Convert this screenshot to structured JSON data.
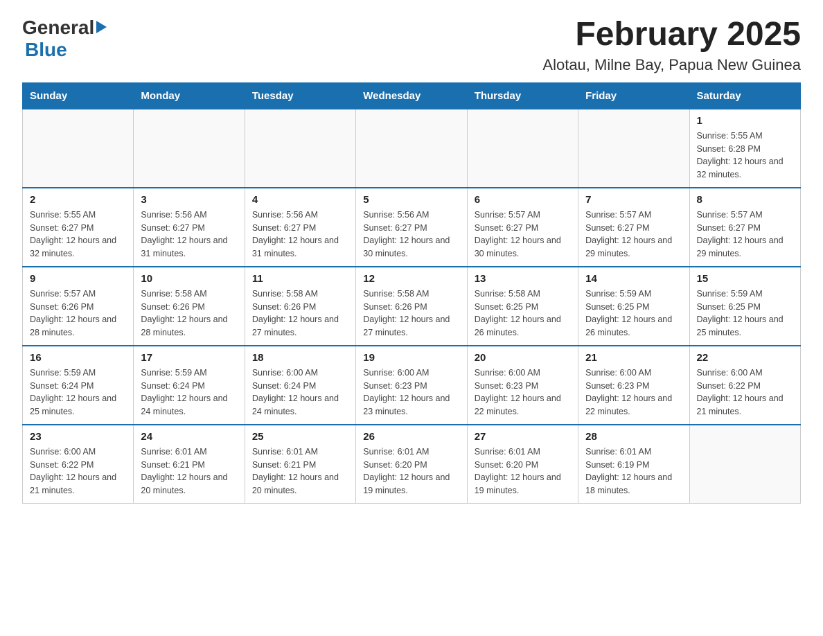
{
  "header": {
    "logo_general": "General",
    "logo_blue": "Blue",
    "month_title": "February 2025",
    "location": "Alotau, Milne Bay, Papua New Guinea"
  },
  "weekdays": [
    "Sunday",
    "Monday",
    "Tuesday",
    "Wednesday",
    "Thursday",
    "Friday",
    "Saturday"
  ],
  "weeks": [
    {
      "days": [
        {
          "number": "",
          "sunrise": "",
          "sunset": "",
          "daylight": "",
          "empty": true
        },
        {
          "number": "",
          "sunrise": "",
          "sunset": "",
          "daylight": "",
          "empty": true
        },
        {
          "number": "",
          "sunrise": "",
          "sunset": "",
          "daylight": "",
          "empty": true
        },
        {
          "number": "",
          "sunrise": "",
          "sunset": "",
          "daylight": "",
          "empty": true
        },
        {
          "number": "",
          "sunrise": "",
          "sunset": "",
          "daylight": "",
          "empty": true
        },
        {
          "number": "",
          "sunrise": "",
          "sunset": "",
          "daylight": "",
          "empty": true
        },
        {
          "number": "1",
          "sunrise": "Sunrise: 5:55 AM",
          "sunset": "Sunset: 6:28 PM",
          "daylight": "Daylight: 12 hours and 32 minutes.",
          "empty": false
        }
      ]
    },
    {
      "days": [
        {
          "number": "2",
          "sunrise": "Sunrise: 5:55 AM",
          "sunset": "Sunset: 6:27 PM",
          "daylight": "Daylight: 12 hours and 32 minutes.",
          "empty": false
        },
        {
          "number": "3",
          "sunrise": "Sunrise: 5:56 AM",
          "sunset": "Sunset: 6:27 PM",
          "daylight": "Daylight: 12 hours and 31 minutes.",
          "empty": false
        },
        {
          "number": "4",
          "sunrise": "Sunrise: 5:56 AM",
          "sunset": "Sunset: 6:27 PM",
          "daylight": "Daylight: 12 hours and 31 minutes.",
          "empty": false
        },
        {
          "number": "5",
          "sunrise": "Sunrise: 5:56 AM",
          "sunset": "Sunset: 6:27 PM",
          "daylight": "Daylight: 12 hours and 30 minutes.",
          "empty": false
        },
        {
          "number": "6",
          "sunrise": "Sunrise: 5:57 AM",
          "sunset": "Sunset: 6:27 PM",
          "daylight": "Daylight: 12 hours and 30 minutes.",
          "empty": false
        },
        {
          "number": "7",
          "sunrise": "Sunrise: 5:57 AM",
          "sunset": "Sunset: 6:27 PM",
          "daylight": "Daylight: 12 hours and 29 minutes.",
          "empty": false
        },
        {
          "number": "8",
          "sunrise": "Sunrise: 5:57 AM",
          "sunset": "Sunset: 6:27 PM",
          "daylight": "Daylight: 12 hours and 29 minutes.",
          "empty": false
        }
      ]
    },
    {
      "days": [
        {
          "number": "9",
          "sunrise": "Sunrise: 5:57 AM",
          "sunset": "Sunset: 6:26 PM",
          "daylight": "Daylight: 12 hours and 28 minutes.",
          "empty": false
        },
        {
          "number": "10",
          "sunrise": "Sunrise: 5:58 AM",
          "sunset": "Sunset: 6:26 PM",
          "daylight": "Daylight: 12 hours and 28 minutes.",
          "empty": false
        },
        {
          "number": "11",
          "sunrise": "Sunrise: 5:58 AM",
          "sunset": "Sunset: 6:26 PM",
          "daylight": "Daylight: 12 hours and 27 minutes.",
          "empty": false
        },
        {
          "number": "12",
          "sunrise": "Sunrise: 5:58 AM",
          "sunset": "Sunset: 6:26 PM",
          "daylight": "Daylight: 12 hours and 27 minutes.",
          "empty": false
        },
        {
          "number": "13",
          "sunrise": "Sunrise: 5:58 AM",
          "sunset": "Sunset: 6:25 PM",
          "daylight": "Daylight: 12 hours and 26 minutes.",
          "empty": false
        },
        {
          "number": "14",
          "sunrise": "Sunrise: 5:59 AM",
          "sunset": "Sunset: 6:25 PM",
          "daylight": "Daylight: 12 hours and 26 minutes.",
          "empty": false
        },
        {
          "number": "15",
          "sunrise": "Sunrise: 5:59 AM",
          "sunset": "Sunset: 6:25 PM",
          "daylight": "Daylight: 12 hours and 25 minutes.",
          "empty": false
        }
      ]
    },
    {
      "days": [
        {
          "number": "16",
          "sunrise": "Sunrise: 5:59 AM",
          "sunset": "Sunset: 6:24 PM",
          "daylight": "Daylight: 12 hours and 25 minutes.",
          "empty": false
        },
        {
          "number": "17",
          "sunrise": "Sunrise: 5:59 AM",
          "sunset": "Sunset: 6:24 PM",
          "daylight": "Daylight: 12 hours and 24 minutes.",
          "empty": false
        },
        {
          "number": "18",
          "sunrise": "Sunrise: 6:00 AM",
          "sunset": "Sunset: 6:24 PM",
          "daylight": "Daylight: 12 hours and 24 minutes.",
          "empty": false
        },
        {
          "number": "19",
          "sunrise": "Sunrise: 6:00 AM",
          "sunset": "Sunset: 6:23 PM",
          "daylight": "Daylight: 12 hours and 23 minutes.",
          "empty": false
        },
        {
          "number": "20",
          "sunrise": "Sunrise: 6:00 AM",
          "sunset": "Sunset: 6:23 PM",
          "daylight": "Daylight: 12 hours and 22 minutes.",
          "empty": false
        },
        {
          "number": "21",
          "sunrise": "Sunrise: 6:00 AM",
          "sunset": "Sunset: 6:23 PM",
          "daylight": "Daylight: 12 hours and 22 minutes.",
          "empty": false
        },
        {
          "number": "22",
          "sunrise": "Sunrise: 6:00 AM",
          "sunset": "Sunset: 6:22 PM",
          "daylight": "Daylight: 12 hours and 21 minutes.",
          "empty": false
        }
      ]
    },
    {
      "days": [
        {
          "number": "23",
          "sunrise": "Sunrise: 6:00 AM",
          "sunset": "Sunset: 6:22 PM",
          "daylight": "Daylight: 12 hours and 21 minutes.",
          "empty": false
        },
        {
          "number": "24",
          "sunrise": "Sunrise: 6:01 AM",
          "sunset": "Sunset: 6:21 PM",
          "daylight": "Daylight: 12 hours and 20 minutes.",
          "empty": false
        },
        {
          "number": "25",
          "sunrise": "Sunrise: 6:01 AM",
          "sunset": "Sunset: 6:21 PM",
          "daylight": "Daylight: 12 hours and 20 minutes.",
          "empty": false
        },
        {
          "number": "26",
          "sunrise": "Sunrise: 6:01 AM",
          "sunset": "Sunset: 6:20 PM",
          "daylight": "Daylight: 12 hours and 19 minutes.",
          "empty": false
        },
        {
          "number": "27",
          "sunrise": "Sunrise: 6:01 AM",
          "sunset": "Sunset: 6:20 PM",
          "daylight": "Daylight: 12 hours and 19 minutes.",
          "empty": false
        },
        {
          "number": "28",
          "sunrise": "Sunrise: 6:01 AM",
          "sunset": "Sunset: 6:19 PM",
          "daylight": "Daylight: 12 hours and 18 minutes.",
          "empty": false
        },
        {
          "number": "",
          "sunrise": "",
          "sunset": "",
          "daylight": "",
          "empty": true
        }
      ]
    }
  ]
}
